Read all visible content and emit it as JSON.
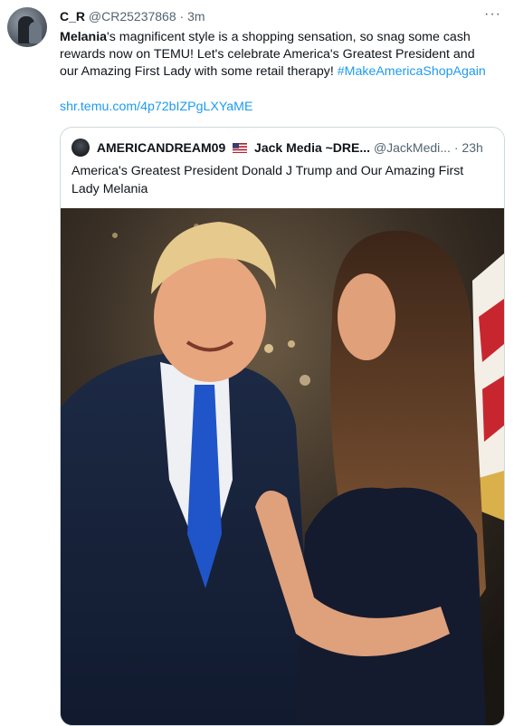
{
  "tweet": {
    "display_name": "C_R",
    "handle": "@CR25237868",
    "separator": "·",
    "time": "3m",
    "more": "···",
    "text_bold": "Melania",
    "text_body": "'s magnificent style is a shopping sensation, so snag some cash rewards now on TEMU! Let's celebrate America's Greatest President and our Amazing First Lady with some retail therapy! ",
    "hashtag": "#MakeAmericaShopAgain",
    "link": "shr.temu.com/4p72bIZPgLXYaME"
  },
  "quote": {
    "display_name": "AMERICANDREAM09",
    "name_suffix": "Jack Media ~DRE...",
    "handle": "@JackMedi...",
    "separator": "·",
    "time": "23h",
    "text": "America's Greatest President Donald J Trump and Our Amazing First Lady Melania"
  },
  "colors": {
    "link": "#1d9bf0",
    "secondary": "#536471",
    "border": "#cfd9de"
  },
  "icons": [
    "more-icon",
    "us-flag-icon"
  ]
}
